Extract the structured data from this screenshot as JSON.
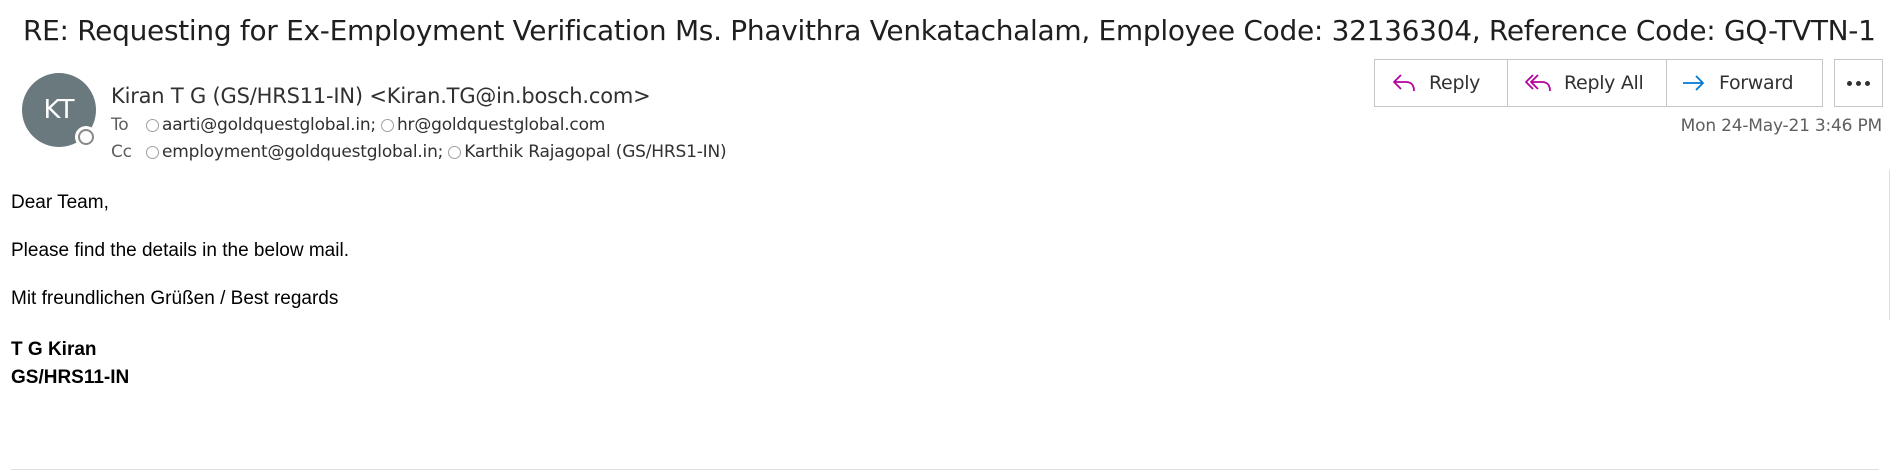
{
  "subject": "RE: Requesting for Ex-Employment Verification Ms. Phavithra Venkatachalam, Employee Code: 32136304, Reference Code: GQ-TVTN-1",
  "sender": {
    "initials": "KT",
    "display": "Kiran T G (GS/HRS11-IN) <Kiran.TG@in.bosch.com>",
    "avatar_color": "#69797e"
  },
  "to": {
    "label": "To",
    "recipients": [
      "aarti@goldquestglobal.in;",
      "hr@goldquestglobal.com"
    ]
  },
  "cc": {
    "label": "Cc",
    "recipients": [
      "employment@goldquestglobal.in;",
      "Karthik Rajagopal (GS/HRS1-IN)"
    ]
  },
  "actions": {
    "reply": "Reply",
    "reply_all": "Reply All",
    "forward": "Forward",
    "reply_icon": "reply-arrow-icon",
    "reply_all_icon": "reply-all-arrow-icon",
    "forward_icon": "forward-arrow-icon",
    "more_icon": "ellipsis-icon",
    "accent_reply": "#b4009e",
    "accent_forward": "#0078d4"
  },
  "date": "Mon 24-May-21 3:46 PM",
  "body": {
    "greeting": "Dear Team,",
    "line1": "Please find the details in the below mail.",
    "closing": "Mit freundlichen Grüßen / Best regards",
    "sig_name": "T G Kiran",
    "sig_dept": "GS/HRS11-IN"
  }
}
